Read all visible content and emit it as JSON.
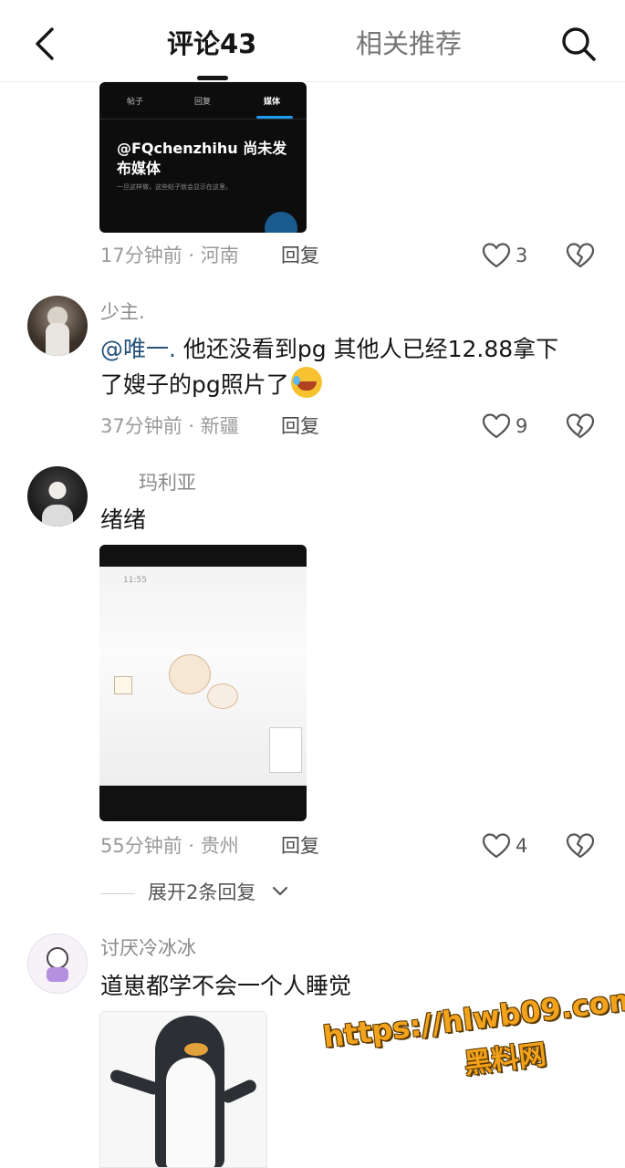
{
  "header": {
    "tab_comments": "评论43",
    "tab_related": "相关推荐"
  },
  "comment1": {
    "image": {
      "tabs": [
        "帖子",
        "回复",
        "媒体"
      ],
      "title": "@FQchenzhihu 尚未发布媒体",
      "subtitle": "一旦这样做，这些帖子就会显示在这里。"
    },
    "meta": "17分钟前 · 河南",
    "reply_label": "回复",
    "likes": "3"
  },
  "comment2": {
    "username": "少主.",
    "mention": "@唯一.",
    "text_line1": " 他还没看到pg 其他人已经12.88拿下",
    "text_line2": "了嫂子的pg照片了",
    "meta": "37分钟前 · 新疆",
    "reply_label": "回复",
    "likes": "9"
  },
  "comment3": {
    "username": "玛利亚",
    "text": "绪绪",
    "image": {
      "time": "11:55"
    },
    "meta": "55分钟前 · 贵州",
    "reply_label": "回复",
    "likes": "4",
    "expand_label": "展开2条回复"
  },
  "comment4": {
    "username": "讨厌冷冰冰",
    "text": "道崽都学不会一个人睡觉"
  },
  "watermark": {
    "url": "https://hlwb09.com",
    "name": "黑料网"
  },
  "colors": {
    "accent_mention": "#24527a",
    "watermark": "#f2a21b"
  }
}
